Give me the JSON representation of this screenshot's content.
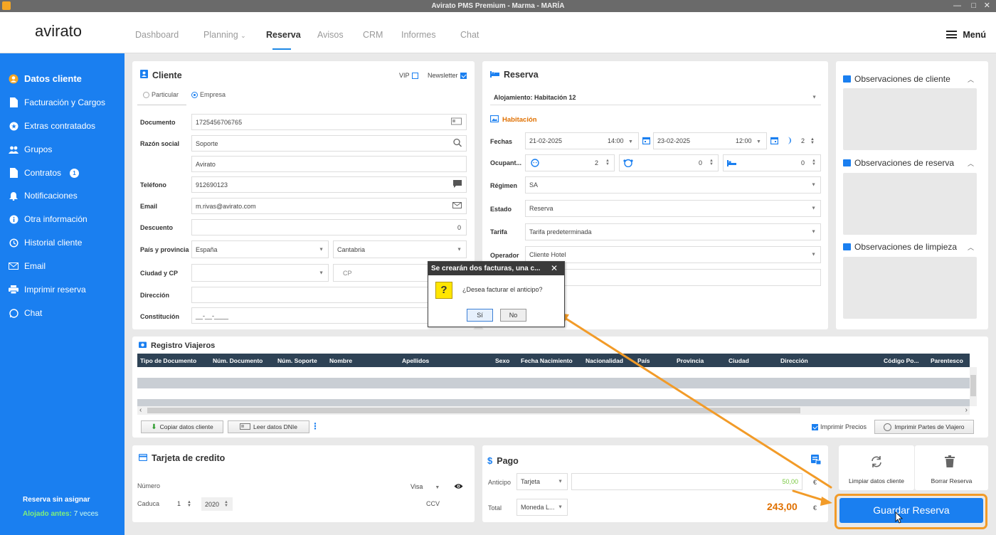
{
  "window": {
    "title": "Avirato PMS Premium - Marma - MARÍA",
    "controls": [
      "—",
      "□",
      "✕"
    ]
  },
  "nav": {
    "logo": "avirato",
    "items": [
      "Dashboard",
      "Planning",
      "Reserva",
      "Avisos",
      "CRM",
      "Informes",
      "Chat"
    ],
    "planning_arrow": "⌄",
    "active": "Reserva",
    "menu_label": "Menú"
  },
  "sidebar": {
    "items": [
      {
        "label": "Datos cliente",
        "icon": "user-circle-icon"
      },
      {
        "label": "Facturación y Cargos",
        "icon": "document-icon"
      },
      {
        "label": "Extras contratados",
        "icon": "star-icon"
      },
      {
        "label": "Grupos",
        "icon": "group-icon"
      },
      {
        "label": "Contratos",
        "icon": "contract-icon",
        "badge": "1"
      },
      {
        "label": "Notificaciones",
        "icon": "bell-icon"
      },
      {
        "label": "Otra información",
        "icon": "info-icon"
      },
      {
        "label": "Historial cliente",
        "icon": "history-icon"
      },
      {
        "label": "Email",
        "icon": "mail-icon"
      },
      {
        "label": "Imprimir reserva",
        "icon": "printer-icon"
      },
      {
        "label": "Chat",
        "icon": "whatsapp-icon"
      }
    ],
    "footer_title": "Reserva sin asignar",
    "footer_label": "Alojado antes:",
    "footer_value": "7 veces"
  },
  "cliente": {
    "title": "Cliente",
    "vip_label": "VIP",
    "vip_checked": false,
    "newsletter_label": "Newsletter",
    "newsletter_checked": true,
    "type_options": [
      "Particular",
      "Empresa"
    ],
    "type_selected": "Empresa",
    "documento_label": "Documento",
    "documento": "1725456706765",
    "razon_label": "Razón social",
    "razon": "Soporte",
    "razon2": "Avirato",
    "telefono_label": "Teléfono",
    "telefono": "912690123",
    "email_label": "Email",
    "email": "m.rivas@avirato.com",
    "descuento_label": "Descuento",
    "descuento": "0",
    "pais_label": "País y provincia",
    "pais": "España",
    "provincia": "Cantabria",
    "ciudad_label": "Ciudad y  CP",
    "ciudad": "",
    "cp_placeholder": "CP",
    "direccion_label": "Dirección",
    "direccion": "",
    "constitucion_label": "Constitución",
    "constitucion": "__-__-____"
  },
  "reserva": {
    "title": "Reserva",
    "alojamiento": "Alojamiento: Habitación 12",
    "habitacion_tab": "Habitación",
    "fechas_label": "Fechas",
    "fecha_in": "21-02-2025",
    "hora_in": "14:00",
    "fecha_out": "23-02-2025",
    "hora_out": "12:00",
    "noches": "2",
    "ocupantes_label": "Ocupant...",
    "adultos": "2",
    "ninos": "0",
    "camas": "0",
    "regimen_label": "Régimen",
    "regimen": "SA",
    "estado_label": "Estado",
    "estado": "Reserva",
    "tarifa_label": "Tarifa",
    "tarifa": "Tarifa predeterminada",
    "operador_label": "Operador",
    "operador": "Cliente Hotel"
  },
  "observaciones": [
    {
      "title": "Observaciones de cliente"
    },
    {
      "title": "Observaciones de reserva"
    },
    {
      "title": "Observaciones de limpieza"
    }
  ],
  "registro": {
    "title": "Registro Viajeros",
    "columns": [
      "Tipo de Documento",
      "Núm. Documento",
      "Núm. Soporte",
      "Nombre",
      "Apellidos",
      "Sexo",
      "Fecha Nacimiento",
      "Nacionalidad",
      "País",
      "Provincia",
      "Ciudad",
      "Dirección",
      "Código Po...",
      "Parentesco"
    ],
    "copiar_btn": "Copiar datos cliente",
    "leer_btn": "Leer datos DNIe",
    "imprimir_precios_label": "Imprimir Precios",
    "imprimir_precios_checked": true,
    "imprimir_partes_btn": "Imprimir Partes de Viajero"
  },
  "tarjeta": {
    "title": "Tarjeta de credito",
    "numero_label": "Número",
    "marca": "Visa",
    "caduca_label": "Caduca",
    "mes": "1",
    "anio": "2020",
    "ccv_label": "CCV"
  },
  "pago": {
    "title": "Pago",
    "anticipo_label": "Anticipo",
    "anticipo_metodo": "Tarjeta",
    "anticipo_valor": "50,00",
    "total_label": "Total",
    "total_moneda": "Moneda L...",
    "total_valor": "243,00",
    "currency": "€"
  },
  "actions": {
    "limpiar": "Limpiar datos cliente",
    "borrar": "Borrar Reserva",
    "guardar": "Guardar Reserva"
  },
  "dialog": {
    "title": "Se crearán dos facturas, una c...",
    "message": "¿Desea facturar el anticipo?",
    "yes": "Sí",
    "no": "No"
  },
  "colors": {
    "accent": "#1a7ff0",
    "highlight": "#f29b28",
    "total": "#e07000",
    "anticipo": "#7ac943"
  }
}
